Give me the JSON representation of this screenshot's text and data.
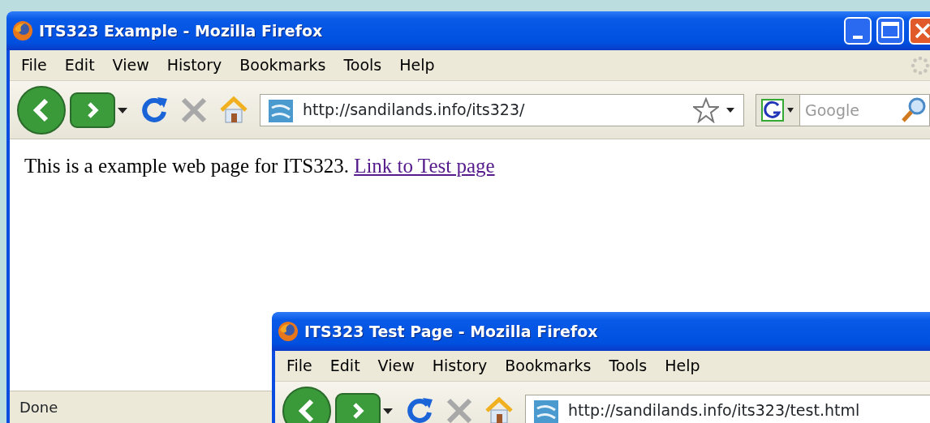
{
  "windows": [
    {
      "title": "ITS323 Example - Mozilla Firefox",
      "caption_buttons": true,
      "menu": [
        "File",
        "Edit",
        "View",
        "History",
        "Bookmarks",
        "Tools",
        "Help"
      ],
      "address": "http://sandilands.info/its323/",
      "search": {
        "placeholder": "Google"
      },
      "content": {
        "text": "This is a example web page for ITS323.",
        "link": "Link to Test page"
      },
      "status": "Done"
    },
    {
      "title": "ITS323 Test Page - Mozilla Firefox",
      "menu": [
        "File",
        "Edit",
        "View",
        "History",
        "Bookmarks",
        "Tools",
        "Help"
      ],
      "address": "http://sandilands.info/its323/test.html"
    }
  ]
}
